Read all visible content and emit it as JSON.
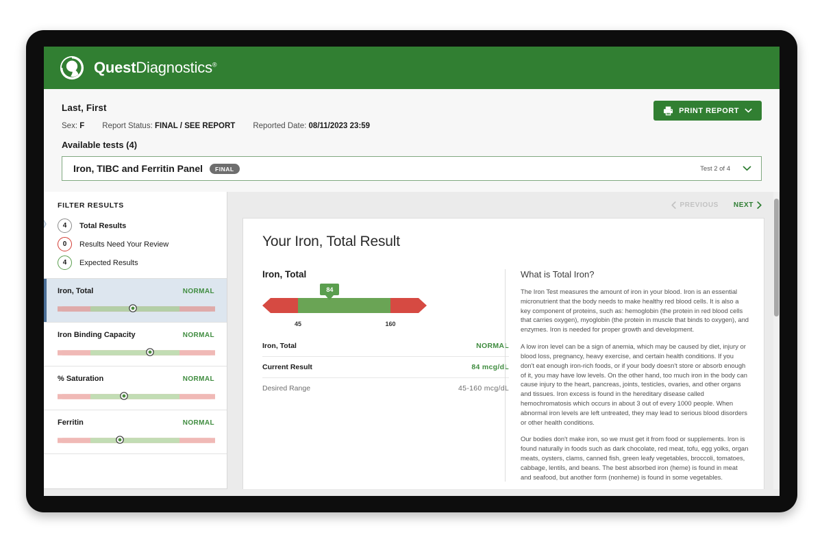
{
  "brand": {
    "name_bold": "Quest",
    "name_light": "Diagnostics",
    "registered": "®",
    "bar_color": "#317f32"
  },
  "header": {
    "patient_name": "Last, First",
    "sex_label": "Sex:",
    "sex_value": "F",
    "report_status_label": "Report Status:",
    "report_status_value": "FINAL / SEE REPORT",
    "reported_date_label": "Reported Date:",
    "reported_date_value": "08/11/2023 23:59",
    "available_tests": "Available tests (4)",
    "print_button": "PRINT REPORT"
  },
  "panel_selector": {
    "title": "Iron, TIBC and Ferritin Panel",
    "badge": "FINAL",
    "count": "Test 2 of 4"
  },
  "sidebar": {
    "filter_header": "FILTER RESULTS",
    "filters": [
      {
        "count": "4",
        "label": "Total Results",
        "tone": "neutral",
        "active": true
      },
      {
        "count": "0",
        "label": "Results Need Your Review",
        "tone": "red",
        "active": false
      },
      {
        "count": "4",
        "label": "Expected Results",
        "tone": "green",
        "active": false
      }
    ],
    "analytes": [
      {
        "name": "Iron, Total",
        "status": "NORMAL",
        "marker_pct": 46,
        "selected": true
      },
      {
        "name": "Iron Binding Capacity",
        "status": "NORMAL",
        "marker_pct": 56,
        "selected": false
      },
      {
        "name": "% Saturation",
        "status": "NORMAL",
        "marker_pct": 42,
        "selected": false
      },
      {
        "name": "Ferritin",
        "status": "NORMAL",
        "marker_pct": 40,
        "selected": false
      }
    ]
  },
  "pager": {
    "previous": "PREVIOUS",
    "next": "NEXT"
  },
  "result": {
    "heading": "Your Iron, Total Result",
    "analyte_title": "Iron, Total",
    "rows": [
      {
        "label": "Iron, Total",
        "value": "NORMAL",
        "muted": false
      },
      {
        "label": "Current Result",
        "value": "84 mcg/dL",
        "muted": false
      },
      {
        "label": "Desired Range",
        "value": "45-160 mcg/dL",
        "muted": true
      }
    ]
  },
  "chart_data": {
    "type": "bar",
    "title": "Iron, Total reference range gauge",
    "unit": "mcg/dL",
    "value": 84,
    "value_label": "84",
    "range_low": 45,
    "range_high": 160,
    "range_low_label": "45",
    "range_high_label": "160",
    "axis_min": 0,
    "axis_max": 205,
    "marker_pct": 41,
    "low_stop_pct": 22,
    "high_stop_pct": 78,
    "status": "NORMAL",
    "colors": {
      "abnormal": "#d64a42",
      "normal": "#6aa455",
      "marker": "#5a9e4e"
    },
    "ylabel": "",
    "xlabel": "mcg/dL"
  },
  "info": {
    "heading": "What is Total Iron?",
    "paragraphs": [
      "The Iron Test measures the amount of iron in your blood. Iron is an essential micronutrient that the body needs to make healthy red blood cells. It is also a key component of proteins, such as: hemoglobin (the protein in red blood cells that carries oxygen), myoglobin (the protein in muscle that binds to oxygen), and enzymes. Iron is needed for proper growth and development.",
      "A low iron level can be a sign of anemia, which may be caused by diet, injury or blood loss, pregnancy, heavy exercise, and certain health conditions. If you don't eat enough iron-rich foods, or if your body doesn't store or absorb enough of it, you may have low levels. On the other hand, too much iron in the body can cause injury to the heart, pancreas, joints, testicles, ovaries, and other organs and tissues. Iron excess is found in the hereditary disease called hemochromatosis which occurs in about 3 out of every 1000 people. When abnormal iron levels are left untreated, they may lead to serious blood disorders or other health conditions.",
      "Our bodies don't make iron, so we must get it from food or supplements. Iron is found naturally in foods such as dark chocolate, red meat, tofu, egg yolks, organ meats, oysters, clams, canned fish, green leafy vegetables, broccoli, tomatoes, cabbage, lentils, and beans. The best absorbed iron (heme) is found in meat and seafood, but another form (nonheme) is found in some vegetables."
    ]
  }
}
